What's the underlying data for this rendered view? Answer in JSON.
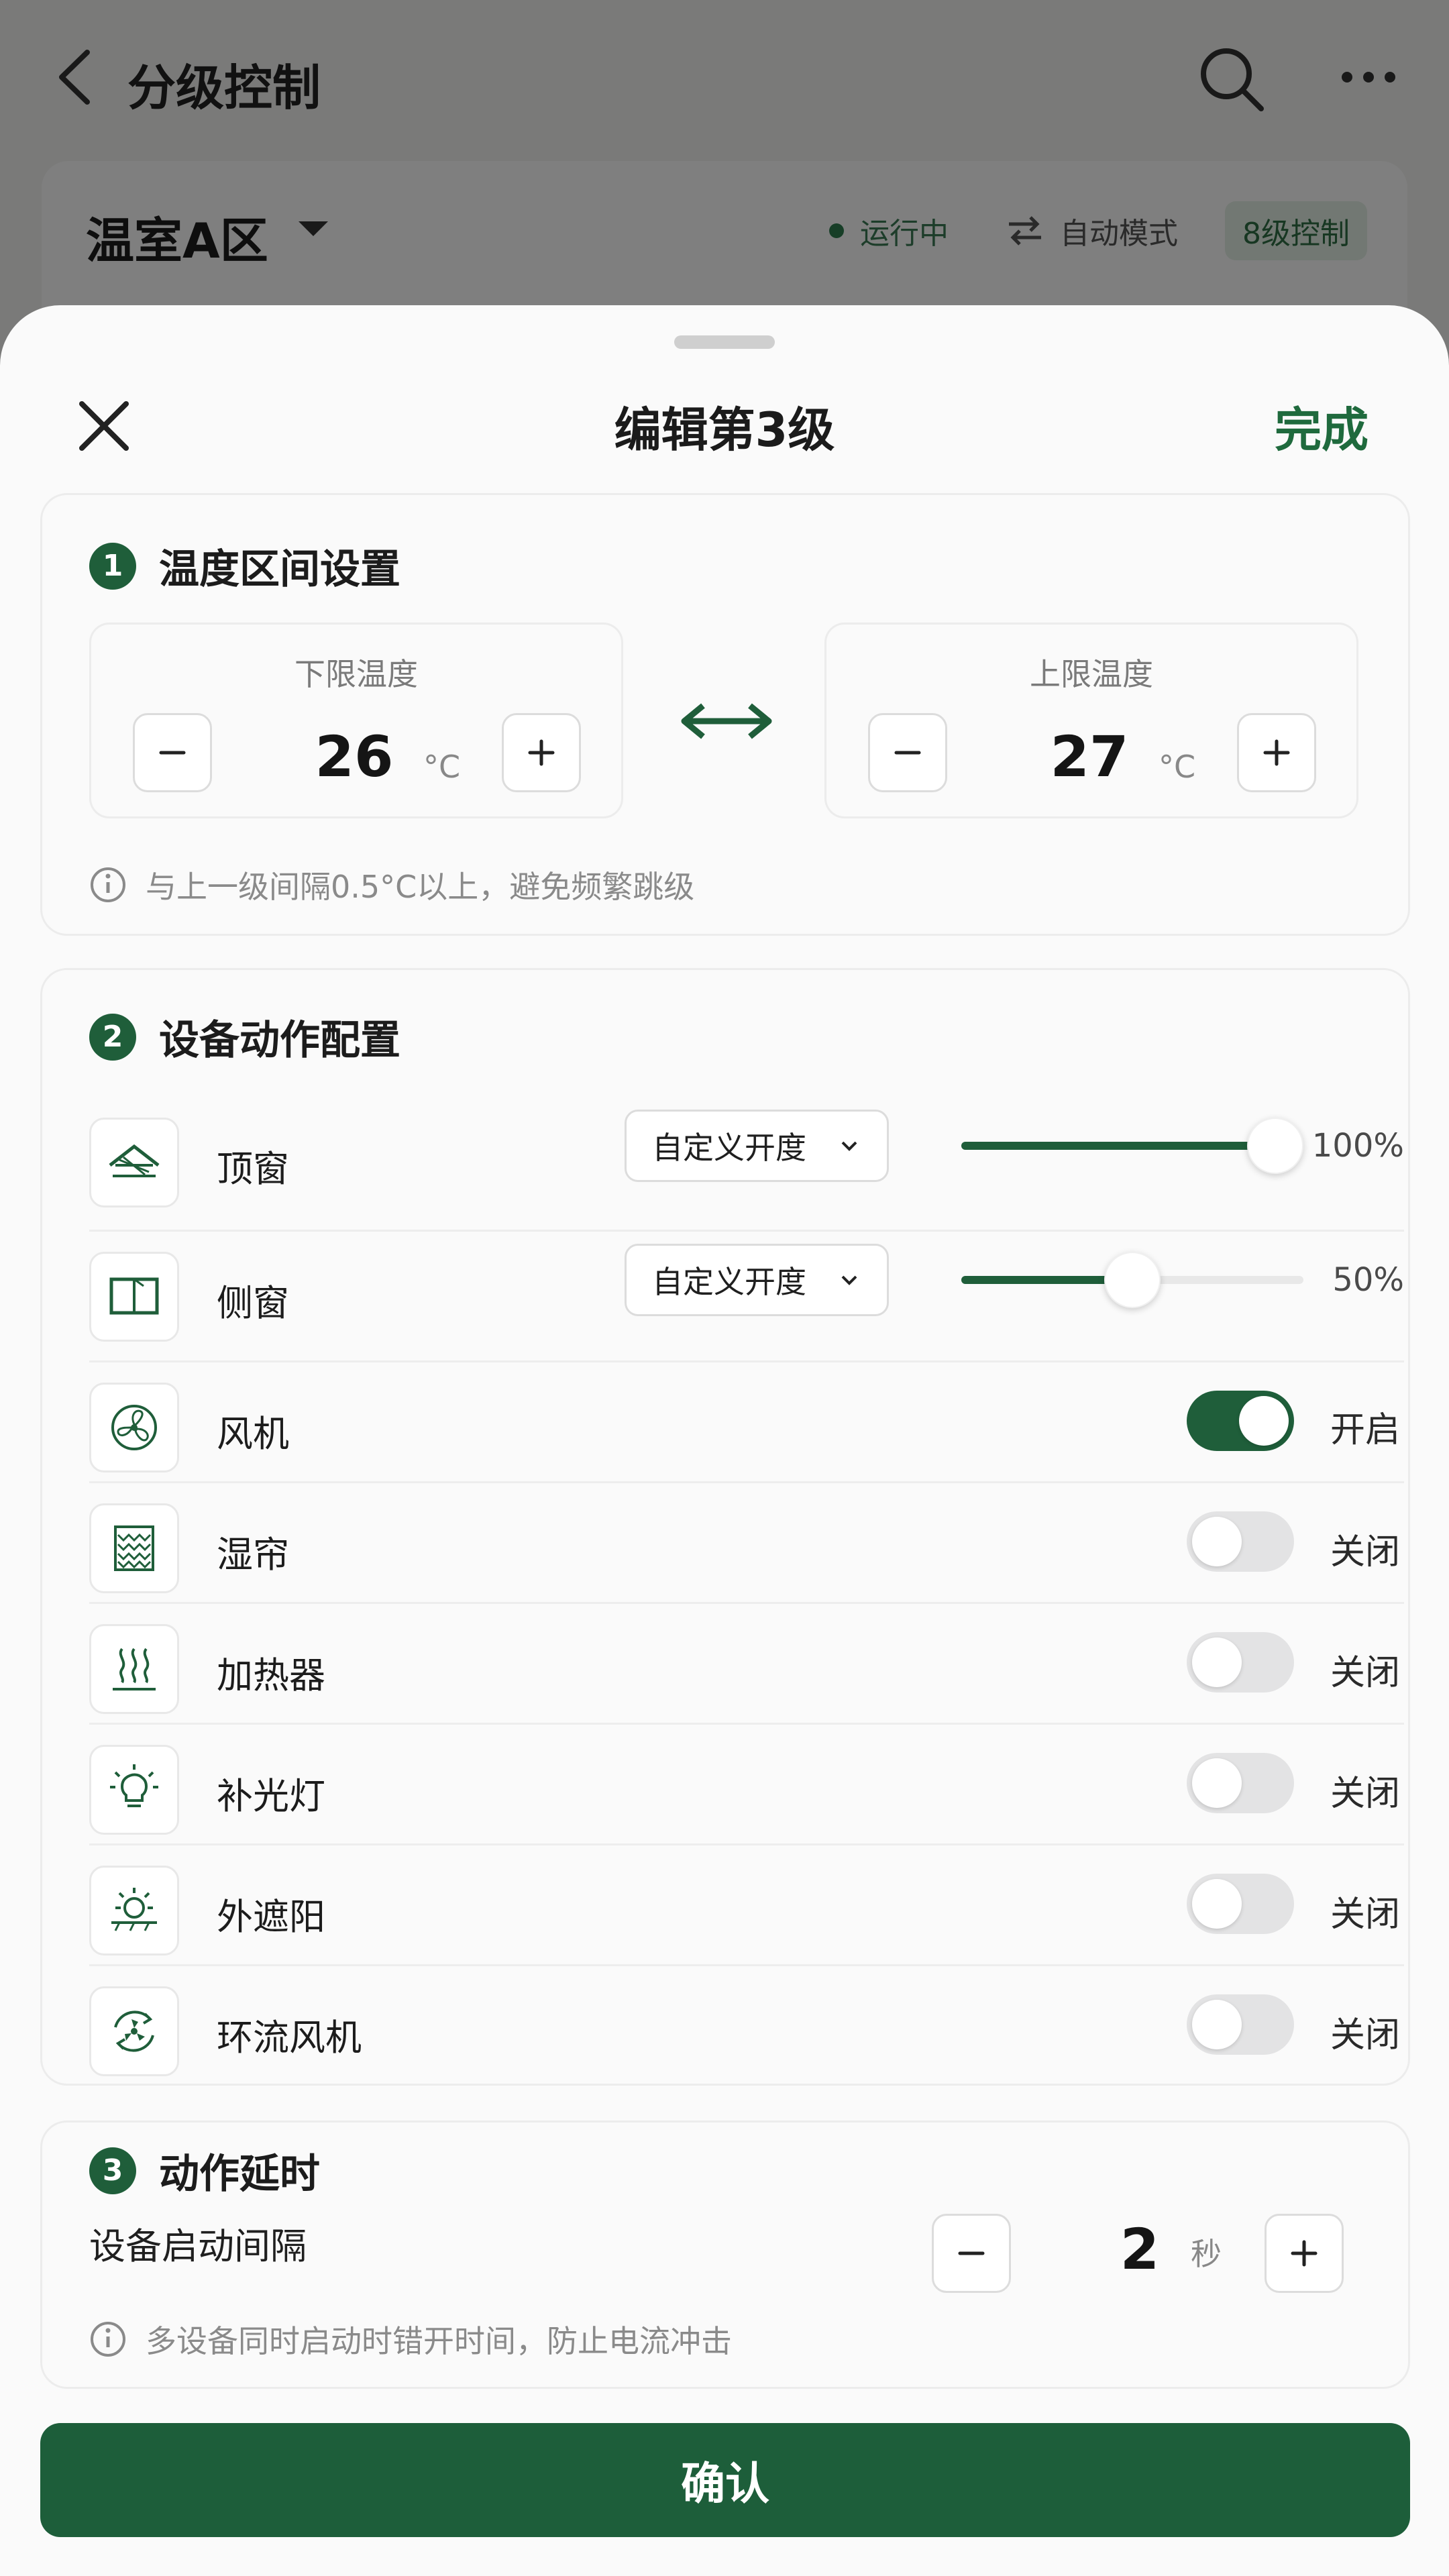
{
  "background": {
    "header_title": "分级控制",
    "zone_name": "温室A区",
    "status_running": "运行中",
    "mode": "自动模式",
    "level_badge": "8级控制"
  },
  "sheet": {
    "title": "编辑第3级",
    "done_label": "完成",
    "confirm_label": "确认"
  },
  "temperature_section": {
    "number": "1",
    "title": "温度区间设置",
    "lower": {
      "label": "下限温度",
      "value": "26",
      "unit": "°C"
    },
    "upper": {
      "label": "上限温度",
      "value": "27",
      "unit": "°C"
    },
    "hint": "与上一级间隔0.5°C以上，避免频繁跳级"
  },
  "device_section": {
    "number": "2",
    "title": "设备动作配置",
    "devices": [
      {
        "name": "顶窗",
        "icon": "roof-window-icon",
        "mode": "自定义开度",
        "level_percent": 100,
        "value_label": "100%"
      },
      {
        "name": "侧窗",
        "icon": "side-window-icon",
        "mode": "自定义开度",
        "level_percent": 50,
        "value_label": "50%"
      },
      {
        "name": "风机",
        "icon": "fan-icon",
        "on": true,
        "state_label": "开启"
      },
      {
        "name": "湿帘",
        "icon": "wet-curtain-icon",
        "on": false,
        "state_label": "关闭"
      },
      {
        "name": "加热器",
        "icon": "heater-icon",
        "on": false,
        "state_label": "关闭"
      },
      {
        "name": "补光灯",
        "icon": "grow-light-icon",
        "on": false,
        "state_label": "关闭"
      },
      {
        "name": "外遮阳",
        "icon": "sunshade-icon",
        "on": false,
        "state_label": "关闭"
      },
      {
        "name": "环流风机",
        "icon": "circulation-fan-icon",
        "on": false,
        "state_label": "关闭"
      }
    ]
  },
  "delay_section": {
    "number": "3",
    "title": "动作延时",
    "label": "设备启动间隔",
    "value": "2",
    "unit": "秒",
    "hint": "多设备同时启动时错开时间，防止电流冲击"
  },
  "colors": {
    "accent": "#1f5e3a",
    "done_text": "#1f6a3d",
    "toggle_off": "#e3e3e4"
  }
}
